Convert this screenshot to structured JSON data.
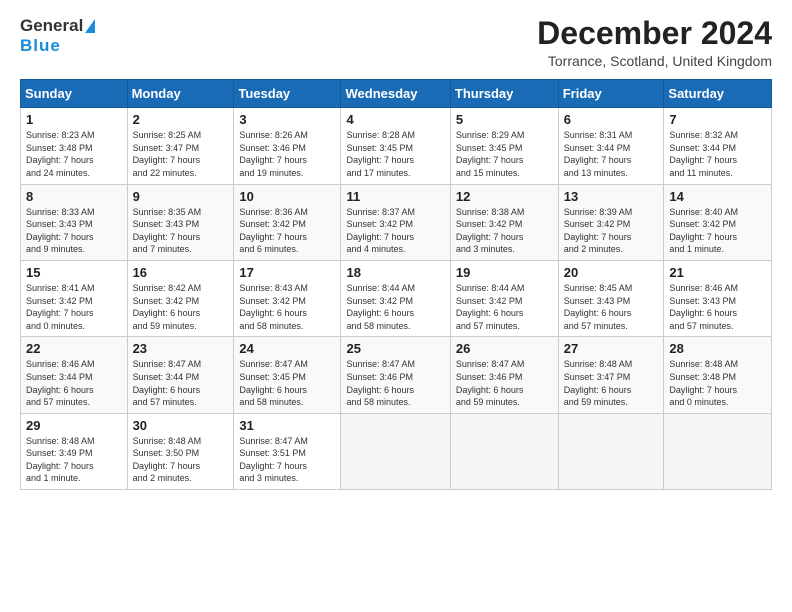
{
  "header": {
    "logo_line1": "General",
    "logo_line2": "Blue",
    "month": "December 2024",
    "location": "Torrance, Scotland, United Kingdom"
  },
  "weekdays": [
    "Sunday",
    "Monday",
    "Tuesday",
    "Wednesday",
    "Thursday",
    "Friday",
    "Saturday"
  ],
  "weeks": [
    [
      {
        "day": "1",
        "lines": [
          "Sunrise: 8:23 AM",
          "Sunset: 3:48 PM",
          "Daylight: 7 hours",
          "and 24 minutes."
        ]
      },
      {
        "day": "2",
        "lines": [
          "Sunrise: 8:25 AM",
          "Sunset: 3:47 PM",
          "Daylight: 7 hours",
          "and 22 minutes."
        ]
      },
      {
        "day": "3",
        "lines": [
          "Sunrise: 8:26 AM",
          "Sunset: 3:46 PM",
          "Daylight: 7 hours",
          "and 19 minutes."
        ]
      },
      {
        "day": "4",
        "lines": [
          "Sunrise: 8:28 AM",
          "Sunset: 3:45 PM",
          "Daylight: 7 hours",
          "and 17 minutes."
        ]
      },
      {
        "day": "5",
        "lines": [
          "Sunrise: 8:29 AM",
          "Sunset: 3:45 PM",
          "Daylight: 7 hours",
          "and 15 minutes."
        ]
      },
      {
        "day": "6",
        "lines": [
          "Sunrise: 8:31 AM",
          "Sunset: 3:44 PM",
          "Daylight: 7 hours",
          "and 13 minutes."
        ]
      },
      {
        "day": "7",
        "lines": [
          "Sunrise: 8:32 AM",
          "Sunset: 3:44 PM",
          "Daylight: 7 hours",
          "and 11 minutes."
        ]
      }
    ],
    [
      {
        "day": "8",
        "lines": [
          "Sunrise: 8:33 AM",
          "Sunset: 3:43 PM",
          "Daylight: 7 hours",
          "and 9 minutes."
        ]
      },
      {
        "day": "9",
        "lines": [
          "Sunrise: 8:35 AM",
          "Sunset: 3:43 PM",
          "Daylight: 7 hours",
          "and 7 minutes."
        ]
      },
      {
        "day": "10",
        "lines": [
          "Sunrise: 8:36 AM",
          "Sunset: 3:42 PM",
          "Daylight: 7 hours",
          "and 6 minutes."
        ]
      },
      {
        "day": "11",
        "lines": [
          "Sunrise: 8:37 AM",
          "Sunset: 3:42 PM",
          "Daylight: 7 hours",
          "and 4 minutes."
        ]
      },
      {
        "day": "12",
        "lines": [
          "Sunrise: 8:38 AM",
          "Sunset: 3:42 PM",
          "Daylight: 7 hours",
          "and 3 minutes."
        ]
      },
      {
        "day": "13",
        "lines": [
          "Sunrise: 8:39 AM",
          "Sunset: 3:42 PM",
          "Daylight: 7 hours",
          "and 2 minutes."
        ]
      },
      {
        "day": "14",
        "lines": [
          "Sunrise: 8:40 AM",
          "Sunset: 3:42 PM",
          "Daylight: 7 hours",
          "and 1 minute."
        ]
      }
    ],
    [
      {
        "day": "15",
        "lines": [
          "Sunrise: 8:41 AM",
          "Sunset: 3:42 PM",
          "Daylight: 7 hours",
          "and 0 minutes."
        ]
      },
      {
        "day": "16",
        "lines": [
          "Sunrise: 8:42 AM",
          "Sunset: 3:42 PM",
          "Daylight: 6 hours",
          "and 59 minutes."
        ]
      },
      {
        "day": "17",
        "lines": [
          "Sunrise: 8:43 AM",
          "Sunset: 3:42 PM",
          "Daylight: 6 hours",
          "and 58 minutes."
        ]
      },
      {
        "day": "18",
        "lines": [
          "Sunrise: 8:44 AM",
          "Sunset: 3:42 PM",
          "Daylight: 6 hours",
          "and 58 minutes."
        ]
      },
      {
        "day": "19",
        "lines": [
          "Sunrise: 8:44 AM",
          "Sunset: 3:42 PM",
          "Daylight: 6 hours",
          "and 57 minutes."
        ]
      },
      {
        "day": "20",
        "lines": [
          "Sunrise: 8:45 AM",
          "Sunset: 3:43 PM",
          "Daylight: 6 hours",
          "and 57 minutes."
        ]
      },
      {
        "day": "21",
        "lines": [
          "Sunrise: 8:46 AM",
          "Sunset: 3:43 PM",
          "Daylight: 6 hours",
          "and 57 minutes."
        ]
      }
    ],
    [
      {
        "day": "22",
        "lines": [
          "Sunrise: 8:46 AM",
          "Sunset: 3:44 PM",
          "Daylight: 6 hours",
          "and 57 minutes."
        ]
      },
      {
        "day": "23",
        "lines": [
          "Sunrise: 8:47 AM",
          "Sunset: 3:44 PM",
          "Daylight: 6 hours",
          "and 57 minutes."
        ]
      },
      {
        "day": "24",
        "lines": [
          "Sunrise: 8:47 AM",
          "Sunset: 3:45 PM",
          "Daylight: 6 hours",
          "and 58 minutes."
        ]
      },
      {
        "day": "25",
        "lines": [
          "Sunrise: 8:47 AM",
          "Sunset: 3:46 PM",
          "Daylight: 6 hours",
          "and 58 minutes."
        ]
      },
      {
        "day": "26",
        "lines": [
          "Sunrise: 8:47 AM",
          "Sunset: 3:46 PM",
          "Daylight: 6 hours",
          "and 59 minutes."
        ]
      },
      {
        "day": "27",
        "lines": [
          "Sunrise: 8:48 AM",
          "Sunset: 3:47 PM",
          "Daylight: 6 hours",
          "and 59 minutes."
        ]
      },
      {
        "day": "28",
        "lines": [
          "Sunrise: 8:48 AM",
          "Sunset: 3:48 PM",
          "Daylight: 7 hours",
          "and 0 minutes."
        ]
      }
    ],
    [
      {
        "day": "29",
        "lines": [
          "Sunrise: 8:48 AM",
          "Sunset: 3:49 PM",
          "Daylight: 7 hours",
          "and 1 minute."
        ]
      },
      {
        "day": "30",
        "lines": [
          "Sunrise: 8:48 AM",
          "Sunset: 3:50 PM",
          "Daylight: 7 hours",
          "and 2 minutes."
        ]
      },
      {
        "day": "31",
        "lines": [
          "Sunrise: 8:47 AM",
          "Sunset: 3:51 PM",
          "Daylight: 7 hours",
          "and 3 minutes."
        ]
      },
      null,
      null,
      null,
      null
    ]
  ]
}
